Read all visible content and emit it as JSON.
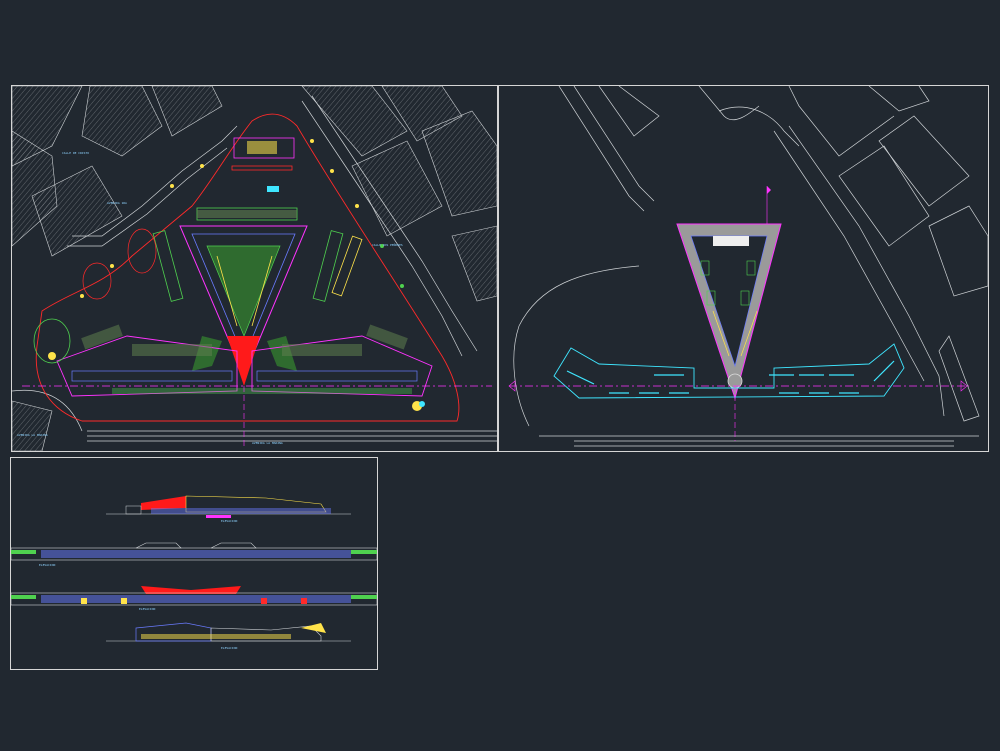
{
  "viewports": [
    {
      "id": "site-plan",
      "street_labels": [
        "CALLE DE CRISTO",
        "AVENIDA 1RA",
        "CALLE DOS PEÑONES",
        "AVENIDA LA MARINA",
        "AVENIDA LA MARINA"
      ]
    },
    {
      "id": "roof-plan"
    },
    {
      "id": "elevations",
      "captions": [
        "ELEVACION",
        "ELEVACION",
        "ELEVACION",
        "ELEVACION"
      ]
    }
  ],
  "colors": {
    "background": "#212830",
    "frame": "#d6d6d6",
    "street": "#cfd3d6",
    "property_line": "#ff2a2a",
    "building": "#ff33ff",
    "structure": "#6a7bff",
    "green": "#4fd14f",
    "yellow": "#ffe34a",
    "cyan": "#3fe6ff",
    "roof_fill": "#9a9a9a",
    "hatch": "#8a8f94"
  }
}
